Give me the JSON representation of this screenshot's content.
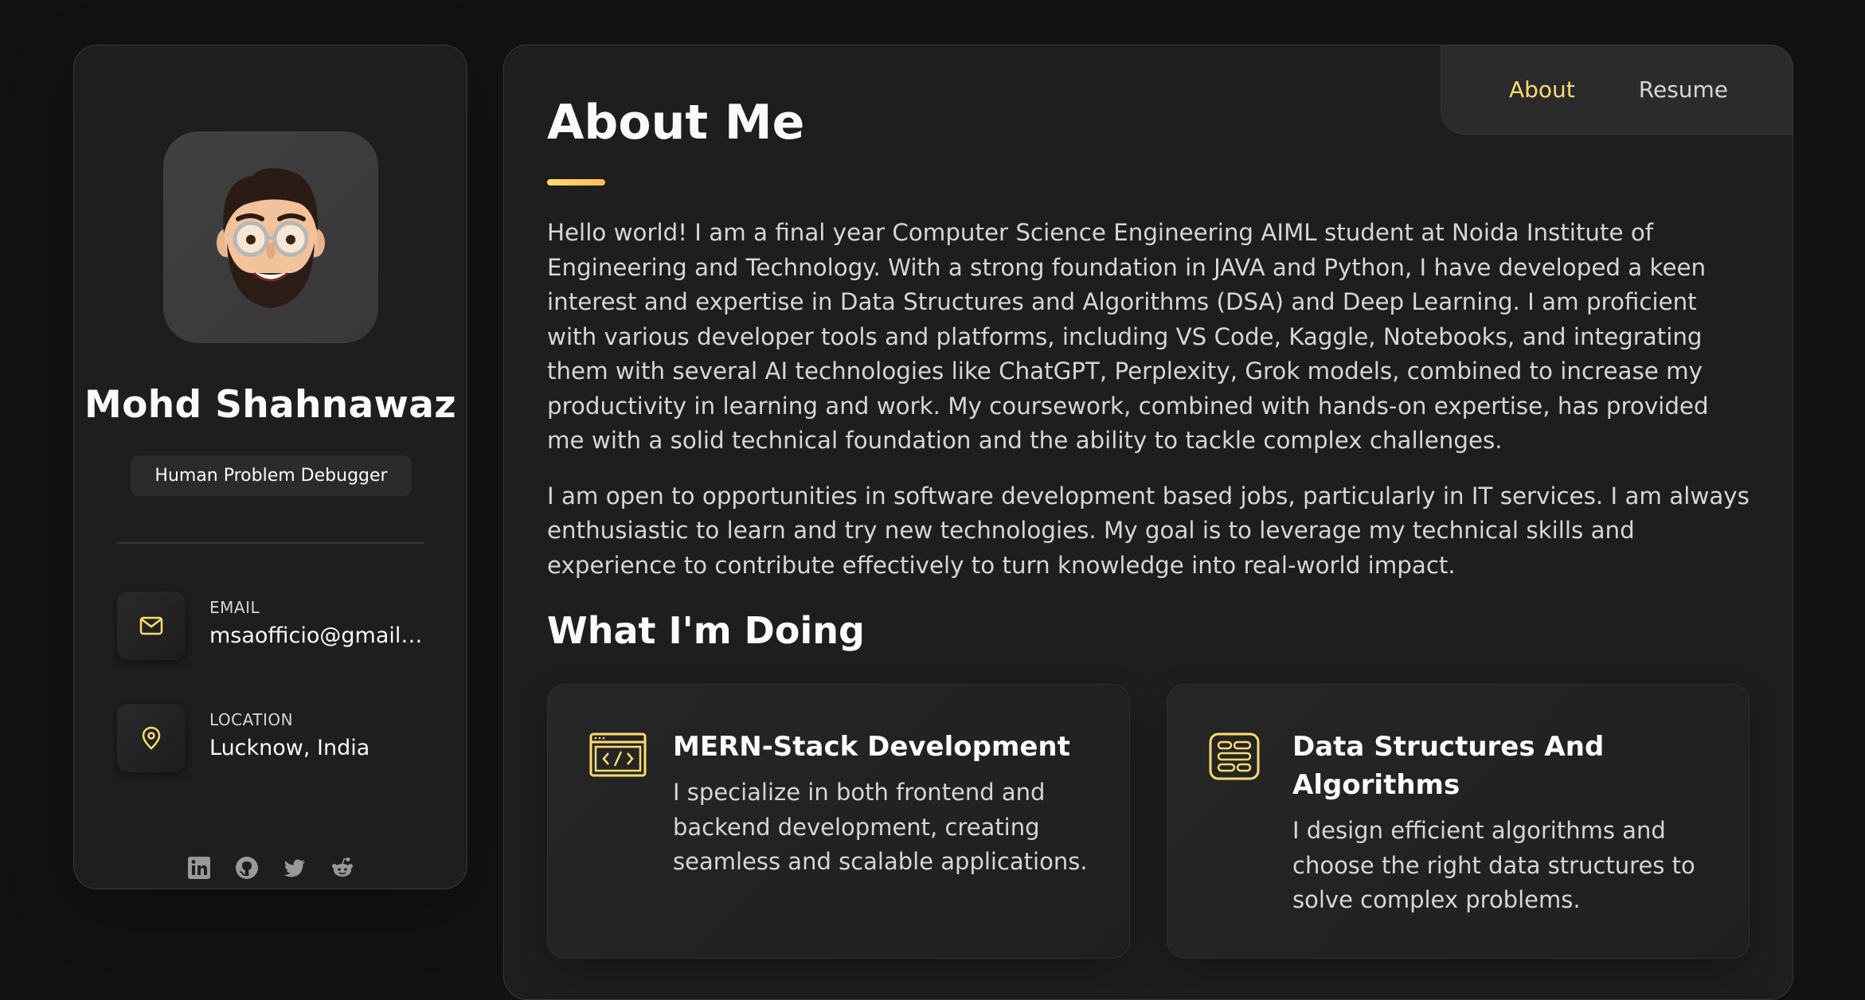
{
  "colors": {
    "accent": "#ffdb70",
    "background": "#121212",
    "card": "#1e1e1f",
    "text": "#fafafa",
    "muted_text": "#d6d6d6"
  },
  "sidebar": {
    "avatar_icon": "memoji-avatar",
    "name": "Mohd Shahnawaz",
    "title": "Human Problem Debugger",
    "contacts": [
      {
        "icon": "mail-icon",
        "label": "EMAIL",
        "value": "msaofficio@gmail.c…"
      },
      {
        "icon": "map-pin-icon",
        "label": "LOCATION",
        "value": "Lucknow, India"
      }
    ],
    "socials": [
      "linkedin-icon",
      "github-icon",
      "twitter-icon",
      "reddit-icon"
    ]
  },
  "navbar": {
    "links": [
      {
        "label": "About",
        "active": true
      },
      {
        "label": "Resume",
        "active": false
      }
    ]
  },
  "about": {
    "title": "About Me",
    "paragraphs": [
      "Hello world! I am a final year Computer Science Engineering AIML student at Noida Institute of Engineering and Technology. With a strong foundation in JAVA and Python, I have developed a keen interest and expertise in Data Structures and Algorithms (DSA) and Deep Learning. I am proficient with various developer tools and platforms, including VS Code, Kaggle, Notebooks, and integrating them with several AI technologies like ChatGPT, Perplexity, Grok models, combined to increase my productivity in learning and work. My coursework, combined with hands-on expertise, has provided me with a solid technical foundation and the ability to tackle complex challenges.",
      "I am open to opportunities in software development based jobs, particularly in IT services. I am always enthusiastic to learn and try new technologies. My goal is to leverage my technical skills and experience to contribute effectively to turn knowledge into real-world impact."
    ]
  },
  "services": {
    "title": "What I'm Doing",
    "items": [
      {
        "icon": "code-window-icon",
        "title": "MERN-Stack Development",
        "text": "I specialize in both frontend and backend development, creating seamless and scalable applications."
      },
      {
        "icon": "data-structure-icon",
        "title": "Data Structures And Algorithms",
        "text": "I design efficient algorithms and choose the right data structures to solve complex problems."
      }
    ]
  }
}
